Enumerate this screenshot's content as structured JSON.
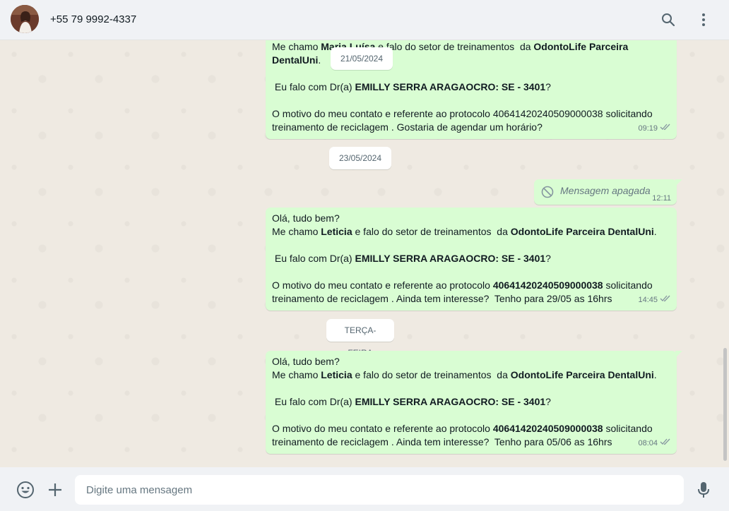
{
  "header": {
    "contact_name": "+55 79 9992-4337",
    "search_icon": "search-icon",
    "menu_icon": "kebab-menu-icon"
  },
  "messages": [
    {
      "id": "msg1",
      "lines": [
        [
          {
            "t": "Me chamo "
          },
          {
            "t": "Maria Luísa",
            "b": true
          },
          {
            "t": " e falo do setor de treinamentos  da "
          },
          {
            "t": "OdontoLife Parceira",
            "b": true
          }
        ],
        [
          {
            "t": "DentalUni",
            "b": true
          },
          {
            "t": "."
          }
        ],
        [],
        [
          {
            "t": " Eu falo com Dr(a) "
          },
          {
            "t": "EMILLY SERRA ARAGAOCRO: SE - 3401",
            "b": true
          },
          {
            "t": "?"
          }
        ],
        [],
        [
          {
            "t": "O motivo do meu contato e referente ao protocolo 40641420240509000038 solicitando"
          }
        ],
        [
          {
            "t": "treinamento de reciclagem . Gostaria de agendar um horário?"
          }
        ]
      ],
      "time": "09:19",
      "status": "read"
    },
    {
      "id": "msg2",
      "deleted_text": "Mensagem apagada",
      "time": "12:11"
    },
    {
      "id": "msg3",
      "lines": [
        [
          {
            "t": "Olá, tudo bem?"
          }
        ],
        [
          {
            "t": "Me chamo "
          },
          {
            "t": "Leticia",
            "b": true
          },
          {
            "t": " e falo do setor de treinamentos  da "
          },
          {
            "t": "OdontoLife Parceira DentalUni",
            "b": true
          },
          {
            "t": "."
          }
        ],
        [],
        [
          {
            "t": " Eu falo com Dr(a) "
          },
          {
            "t": "EMILLY SERRA ARAGAOCRO: SE - 3401",
            "b": true
          },
          {
            "t": "?"
          }
        ],
        [],
        [
          {
            "t": "O motivo do meu contato e referente ao protocolo "
          },
          {
            "t": "40641420240509000038",
            "b": true
          },
          {
            "t": " solicitando"
          }
        ],
        [
          {
            "t": "treinamento de reciclagem . Ainda tem interesse?  Tenho para 29/05 as 16hrs"
          }
        ]
      ],
      "time": "14:45",
      "status": "read"
    },
    {
      "id": "msg4",
      "lines": [
        [
          {
            "t": "Olá, tudo bem?"
          }
        ],
        [
          {
            "t": "Me chamo "
          },
          {
            "t": "Leticia",
            "b": true
          },
          {
            "t": " e falo do setor de treinamentos  da "
          },
          {
            "t": "OdontoLife Parceira DentalUni",
            "b": true
          },
          {
            "t": "."
          }
        ],
        [],
        [
          {
            "t": " Eu falo com Dr(a) "
          },
          {
            "t": "EMILLY SERRA ARAGAOCRO: SE - 3401",
            "b": true
          },
          {
            "t": "?"
          }
        ],
        [],
        [
          {
            "t": "O motivo do meu contato e referente ao protocolo "
          },
          {
            "t": "40641420240509000038",
            "b": true
          },
          {
            "t": " solicitando"
          }
        ],
        [
          {
            "t": "treinamento de reciclagem . Ainda tem interesse?  Tenho para 05/06 as 16hrs"
          }
        ]
      ],
      "time": "08:04",
      "status": "read"
    }
  ],
  "dates": {
    "d1": "21/05/2024",
    "d2": "23/05/2024",
    "d3": "TERÇA-FEIRA"
  },
  "footer": {
    "placeholder": "Digite uma mensagem",
    "emoji_icon": "emoji-icon",
    "attach_icon": "plus-icon",
    "mic_icon": "microphone-icon"
  },
  "colors": {
    "outgoing_bubble": "#d9fdd3",
    "chat_background": "#efeae2",
    "header_background": "#f0f2f5"
  }
}
